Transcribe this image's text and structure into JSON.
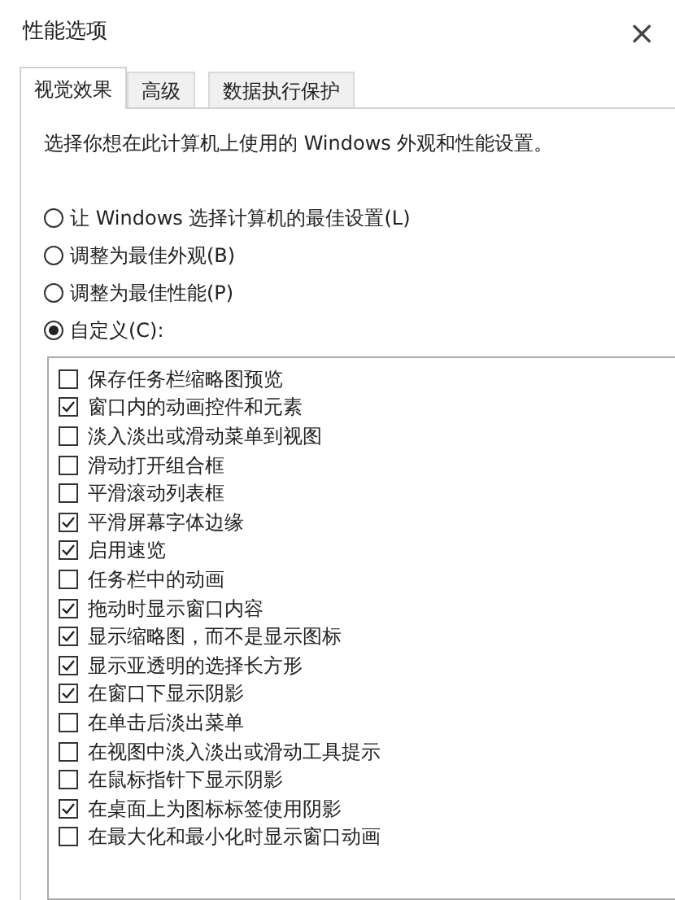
{
  "window": {
    "title": "性能选项",
    "close": "×"
  },
  "tabs": [
    {
      "label": "视觉效果",
      "selected": true
    },
    {
      "label": "高级",
      "selected": false
    },
    {
      "label": "数据执行保护",
      "selected": false
    }
  ],
  "description": "选择你想在此计算机上使用的 Windows 外观和性能设置。",
  "options": [
    {
      "label": "让 Windows 选择计算机的最佳设置(L)",
      "selected": false
    },
    {
      "label": "调整为最佳外观(B)",
      "selected": false
    },
    {
      "label": "调整为最佳性能(P)",
      "selected": false
    },
    {
      "label": "自定义(C):",
      "selected": true
    }
  ],
  "effects": [
    {
      "label": "保存任务栏缩略图预览",
      "checked": false
    },
    {
      "label": "窗口内的动画控件和元素",
      "checked": true
    },
    {
      "label": "淡入淡出或滑动菜单到视图",
      "checked": false
    },
    {
      "label": "滑动打开组合框",
      "checked": false
    },
    {
      "label": "平滑滚动列表框",
      "checked": false
    },
    {
      "label": "平滑屏幕字体边缘",
      "checked": true
    },
    {
      "label": "启用速览",
      "checked": true
    },
    {
      "label": "任务栏中的动画",
      "checked": false
    },
    {
      "label": "拖动时显示窗口内容",
      "checked": true
    },
    {
      "label": "显示缩略图，而不是显示图标",
      "checked": true
    },
    {
      "label": "显示亚透明的选择长方形",
      "checked": true
    },
    {
      "label": "在窗口下显示阴影",
      "checked": true
    },
    {
      "label": "在单击后淡出菜单",
      "checked": false
    },
    {
      "label": "在视图中淡入淡出或滑动工具提示",
      "checked": false
    },
    {
      "label": "在鼠标指针下显示阴影",
      "checked": false
    },
    {
      "label": "在桌面上为图标标签使用阴影",
      "checked": true
    },
    {
      "label": "在最大化和最小化时显示窗口动画",
      "checked": false
    }
  ]
}
